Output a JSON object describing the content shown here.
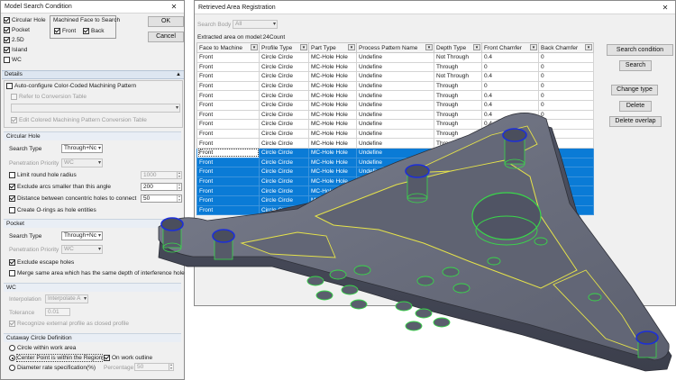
{
  "left_dialog": {
    "title": "Model Search Condition",
    "close_glyph": "✕",
    "targets": [
      {
        "label": "Circular Hole",
        "checked": true
      },
      {
        "label": "Pocket",
        "checked": true
      },
      {
        "label": "2.5D",
        "checked": true
      },
      {
        "label": "Island",
        "checked": true
      },
      {
        "label": "WC",
        "checked": false
      }
    ],
    "machined_face": {
      "title": "Machined Face to Search",
      "front_label": "Front",
      "back_label": "Back"
    },
    "ok_label": "OK",
    "cancel_label": "Cancel",
    "details_title": "Details",
    "collapse_glyph": "▲",
    "auto_color": {
      "label": "Auto-configure Color-Coded Machining Pattern",
      "refer_label": "Refer to Conversion Table",
      "edit_label": "Edit Colored Machining Pattern Conversion Table"
    },
    "circular_hole": {
      "title": "Circular Hole",
      "search_type_label": "Search Type",
      "search_type_value": "Through+Nc",
      "priority_label": "Penetration Priority",
      "priority_value": "WC",
      "limit_label": "Limit round hole radius",
      "limit_value": "1000",
      "exclude_arcs_label": "Exclude arcs smaller than this angle",
      "exclude_arcs_value": "200",
      "distance_label": "Distance between concentric holes to connect",
      "distance_value": "50",
      "orings_label": "Create O-rings as hole entities"
    },
    "pocket": {
      "title": "Pocket",
      "search_type_label": "Search Type",
      "search_type_value": "Through+Nc",
      "priority_label": "Penetration Priority",
      "priority_value": "WC",
      "escape_label": "Exclude escape holes",
      "merge_label": "Merge same area which has the same depth of interference hole"
    },
    "wc": {
      "title": "WC",
      "interpolation_label": "Interpolation",
      "interpolation_value": "Interpolate A",
      "tolerance_label": "Tolerance",
      "tolerance_value": "0.01",
      "recognize_label": "Recognize external profile as closed profile"
    },
    "cutaway": {
      "title": "Cutaway Circle Definition",
      "opt1": "Circle within work area",
      "opt2": "Center Point is within the Region",
      "on_outline": "On work outline",
      "opt3": "Diameter rate specification(%)",
      "percentage_label": "Percentage",
      "percentage_value": "50"
    }
  },
  "right_window": {
    "title": "Retrieved Area Registration",
    "close_glyph": "✕",
    "search_body_label": "Search Body",
    "search_body_value": "All",
    "extracted_label": "Extracted area on model:24Count",
    "columns": [
      "Face to Machine",
      "Profile Type",
      "Part Type",
      "Process Pattern Name",
      "Depth Type",
      "Front Chamfer",
      "Back Chamfer"
    ],
    "rows": [
      [
        "Front",
        "Circle Circle",
        "MC-Hole Hole",
        "Undefine",
        "Not Through",
        "0.4",
        "0"
      ],
      [
        "Front",
        "Circle Circle",
        "MC-Hole Hole",
        "Undefine",
        "Through",
        "0",
        "0"
      ],
      [
        "Front",
        "Circle Circle",
        "MC-Hole Hole",
        "Undefine",
        "Not Through",
        "0.4",
        "0"
      ],
      [
        "Front",
        "Circle Circle",
        "MC-Hole Hole",
        "Undefine",
        "Through",
        "0",
        "0"
      ],
      [
        "Front",
        "Circle Circle",
        "MC-Hole Hole",
        "Undefine",
        "Through",
        "0.4",
        "0"
      ],
      [
        "Front",
        "Circle Circle",
        "MC-Hole Hole",
        "Undefine",
        "Through",
        "0.4",
        "0"
      ],
      [
        "Front",
        "Circle Circle",
        "MC-Hole Hole",
        "Undefine",
        "Through",
        "0.4",
        "0"
      ],
      [
        "Front",
        "Circle Circle",
        "MC-Hole Hole",
        "Undefine",
        "Through",
        "0.4",
        "0"
      ],
      [
        "Front",
        "Circle Circle",
        "MC-Hole Hole",
        "Undefine",
        "Through",
        "0.4",
        "0"
      ],
      [
        "Front",
        "Circle Circle",
        "MC-Hole Hole",
        "Undefine",
        "Through",
        "0.4",
        "0"
      ],
      [
        "Front",
        "Circle Circle",
        "MC-Hole Hole",
        "Undefine",
        "Through",
        "0.4",
        "0"
      ],
      [
        "Front",
        "Circle Circle",
        "MC-Hole Hole",
        "Undefine",
        "Through",
        "0.4",
        "0"
      ],
      [
        "Front",
        "Circle Circle",
        "MC-Hole Hole",
        "Undefine",
        "Through",
        "0.4",
        "0"
      ],
      [
        "Front",
        "Circle Circle",
        "MC-Hole Hole",
        "Undefine",
        "Through",
        "0.4",
        "0"
      ],
      [
        "Front",
        "Circle Circle",
        "MC-Hole Hole",
        "Undefine",
        "Through",
        "0.4",
        "0"
      ],
      [
        "Front",
        "Circle Circle",
        "MC-Hole Hole",
        "Undefine",
        "Through",
        "0.4",
        "0"
      ],
      [
        "Front",
        "Circle Circle",
        "MC-Hole Hole",
        "Undefine",
        "Through",
        "0.4",
        "0"
      ]
    ],
    "buttons": {
      "search_condition": "Search condition",
      "search": "Search",
      "change_type": "Change type",
      "delete": "Delete",
      "delete_overlap": "Delete overlap"
    }
  },
  "colors": {
    "selection": "#0a7bd6",
    "model_body": "#6d7180",
    "hole_green": "#39d84a",
    "hole_blue": "#1c2fd8",
    "edge_yellow": "#e6e34a"
  }
}
